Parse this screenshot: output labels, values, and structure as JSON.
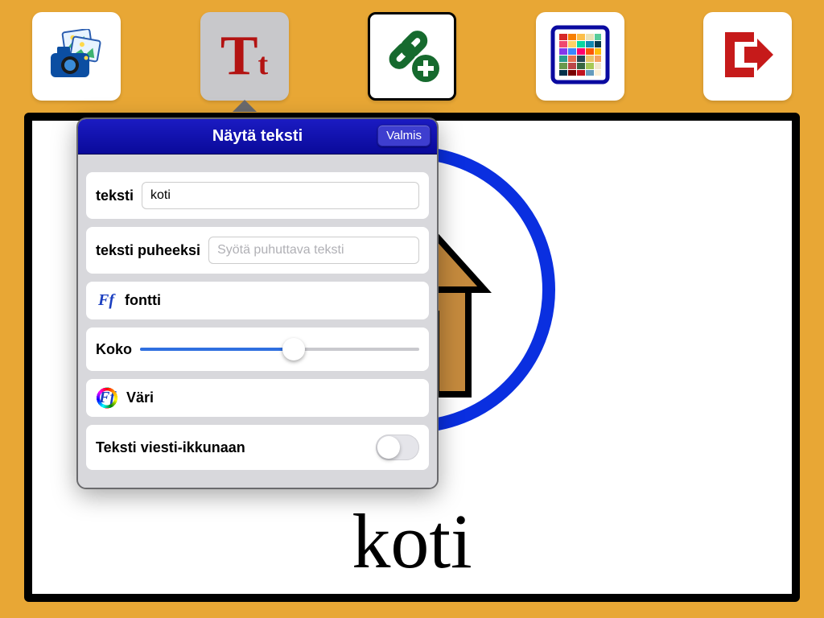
{
  "toolbar": {
    "items": [
      "images-icon",
      "text-icon",
      "link-icon",
      "color-grid-icon",
      "exit-icon"
    ],
    "active_index": 1
  },
  "card": {
    "label": "koti"
  },
  "popover": {
    "title": "Näytä teksti",
    "done": "Valmis",
    "text_label": "teksti",
    "text_value": "koti",
    "speech_label": "teksti puheeksi",
    "speech_placeholder": "Syötä puhuttava teksti",
    "font_label": "fontti",
    "size_label": "Koko",
    "size_value": 55,
    "color_label": "Väri",
    "toggle_label": "Teksti viesti-ikkunaan",
    "toggle_on": false
  }
}
